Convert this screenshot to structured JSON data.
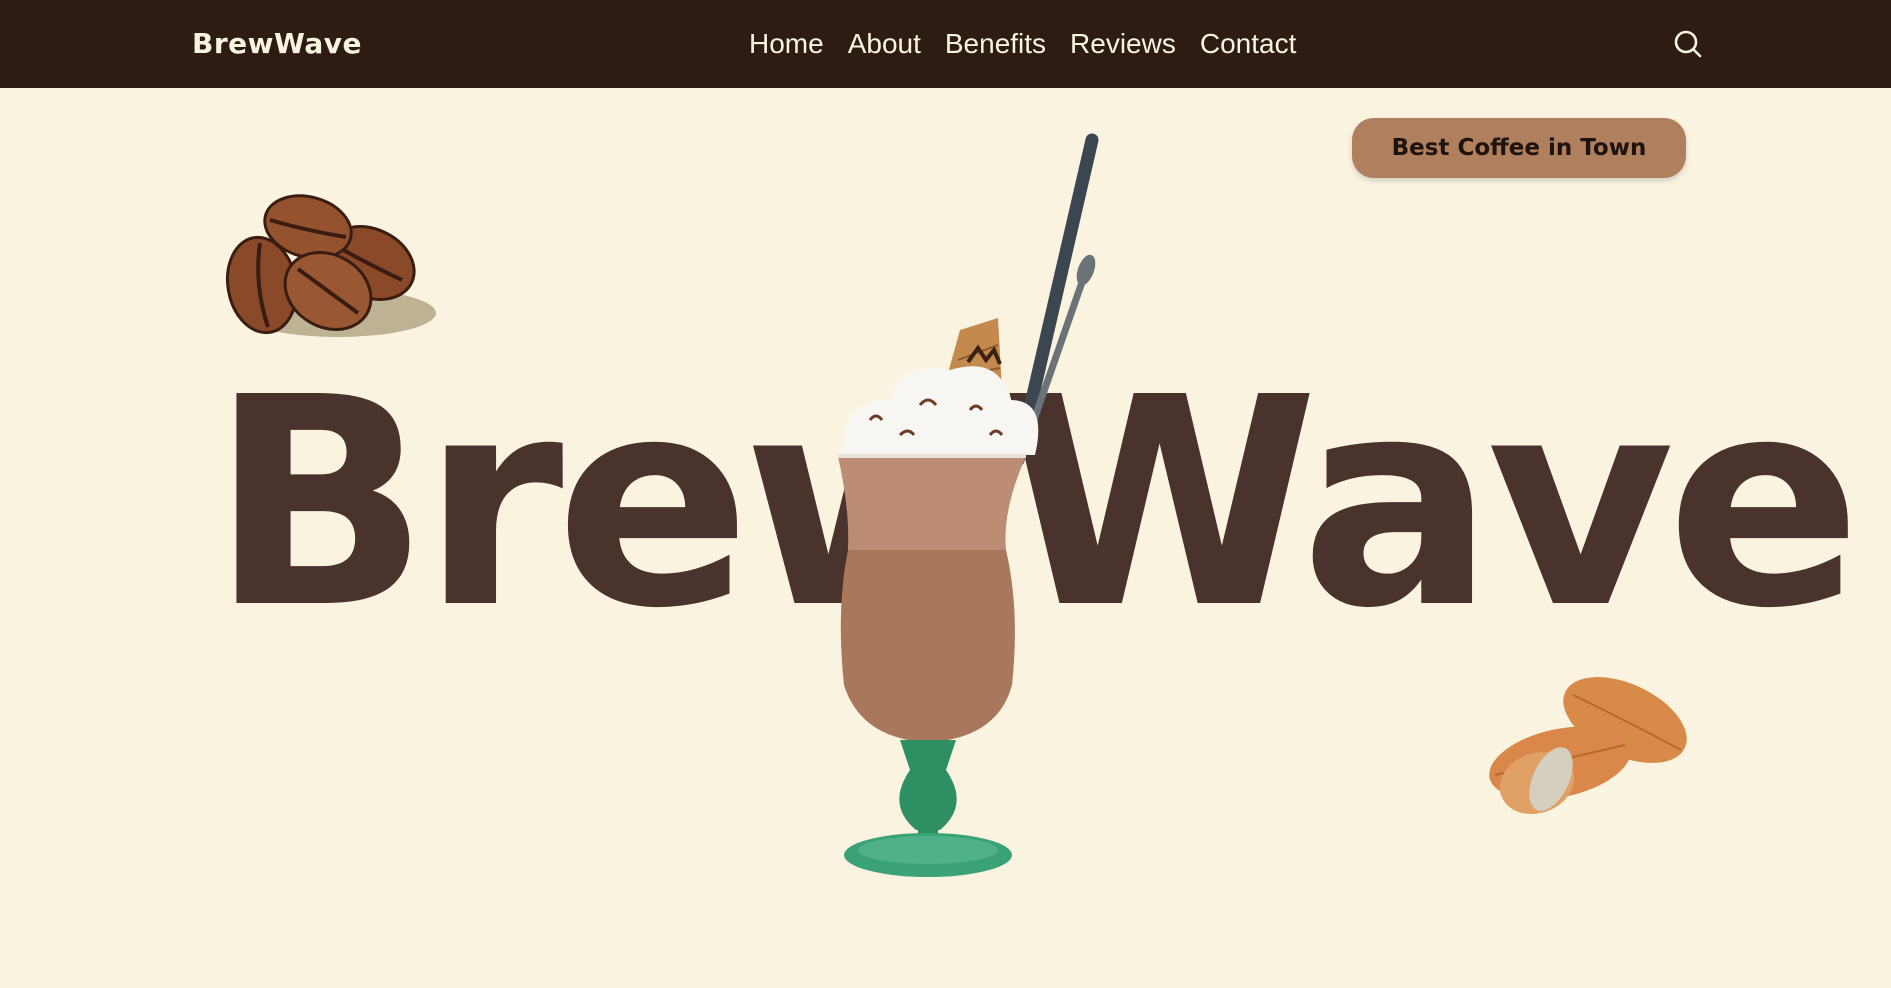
{
  "navbar": {
    "brand": "BrewWave",
    "links": [
      "Home",
      "About",
      "Benefits",
      "Reviews",
      "Contact"
    ],
    "search_icon": "search-icon"
  },
  "hero": {
    "badge_label": "Best Coffee in Town",
    "title": "BrewWave",
    "images": {
      "left": "coffee-beans-illustration",
      "center": "iced-mocha-glass",
      "right": "almonds-illustration"
    }
  },
  "colors": {
    "navbar_bg": "#2c1c14",
    "page_bg": "#faf3e0",
    "title_text": "#4a332d",
    "badge_bg": "#b07f5e",
    "nav_text": "#faf3e0"
  }
}
